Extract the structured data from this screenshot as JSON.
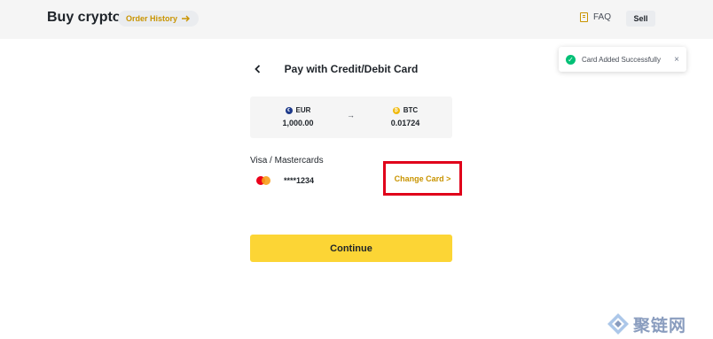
{
  "header": {
    "title": "Buy crypto",
    "order_history_label": "Order History",
    "faq_label": "FAQ",
    "sell_label": "Sell"
  },
  "toast": {
    "message": "Card Added Successfully",
    "close": "×",
    "status_color": "#02c076"
  },
  "payment": {
    "back_icon": "‹",
    "title": "Pay with Credit/Debit Card",
    "from": {
      "currency": "EUR",
      "amount": "1,000.00",
      "icon": "euro-coin-icon",
      "color": "#1e3a8a"
    },
    "arrow": "→",
    "to": {
      "currency": "BTC",
      "amount": "0.01724",
      "icon": "bitcoin-coin-icon",
      "color": "#f0b90b"
    },
    "section_label": "Visa / Mastercards",
    "card_number": "****1234",
    "change_card_label": "Change Card >",
    "continue_label": "Continue"
  },
  "colors": {
    "accent": "#fcd535",
    "link": "#c99400",
    "highlight_border": "#e0001a"
  },
  "watermark": {
    "text": "聚链网"
  }
}
